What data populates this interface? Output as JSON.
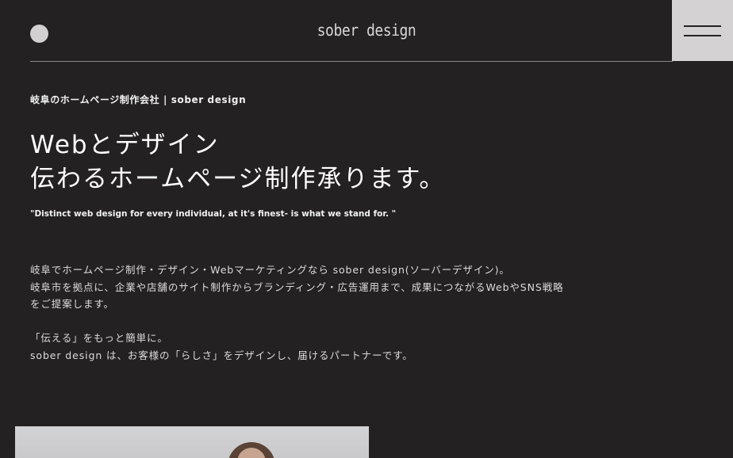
{
  "header": {
    "logo": "sober design",
    "menu_icon": "hamburger-menu-icon"
  },
  "hero": {
    "eyebrow": "岐阜のホームページ制作会社 | sober design",
    "headline_line1": "Webとデザイン",
    "headline_line2": "伝わるホームページ制作承ります。",
    "tagline": "\"Distinct web design for every individual, at it's finest- is what we stand for. \""
  },
  "intro": {
    "line1": "岐阜でホームページ制作・デザイン・Webマーケティングなら sober design(ソーバーデザイン)。",
    "line2": "岐阜市を拠点に、企業や店舗のサイト制作からブランディング・広告運用まで、成果につながるWebやSNS戦略",
    "line3": "をご提案します。",
    "line4": "「伝える」をもっと簡単に。",
    "line5": "sober design は、お客様の「らしさ」をデザインし、届けるパートナーです。"
  },
  "colors": {
    "background": "#232122",
    "menu_button": "#d4d2d2",
    "text": "#ffffff"
  }
}
